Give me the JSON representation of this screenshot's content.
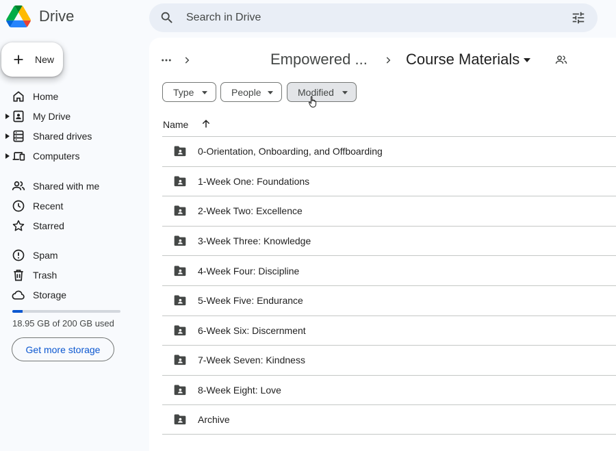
{
  "app": {
    "title": "Drive"
  },
  "search": {
    "placeholder": "Search in Drive"
  },
  "sidebar": {
    "new_label": "New",
    "items": [
      {
        "label": "Home",
        "icon": "home-icon"
      },
      {
        "label": "My Drive",
        "icon": "my-drive-icon"
      },
      {
        "label": "Shared drives",
        "icon": "shared-drives-icon"
      },
      {
        "label": "Computers",
        "icon": "computers-icon"
      },
      {
        "label": "Shared with me",
        "icon": "shared-with-me-icon"
      },
      {
        "label": "Recent",
        "icon": "clock-icon"
      },
      {
        "label": "Starred",
        "icon": "star-icon"
      },
      {
        "label": "Spam",
        "icon": "spam-icon"
      },
      {
        "label": "Trash",
        "icon": "trash-icon"
      },
      {
        "label": "Storage",
        "icon": "cloud-icon"
      }
    ],
    "storage": {
      "used_text": "18.95 GB of 200 GB used",
      "used_fraction": 0.095,
      "button_label": "Get more storage"
    }
  },
  "breadcrumb": {
    "parent": "Empowered ...",
    "current": "Course Materials"
  },
  "filters": {
    "type": "Type",
    "people": "People",
    "modified": "Modified"
  },
  "list": {
    "column_name": "Name",
    "items": [
      "0-Orientation, Onboarding, and Offboarding",
      "1-Week One: Foundations",
      "2-Week Two: Excellence",
      "3-Week Three: Knowledge",
      "4-Week Four: Discipline",
      "5-Week Five: Endurance",
      "6-Week Six: Discernment",
      "7-Week Seven: Kindness",
      "8-Week Eight: Love",
      "Archive"
    ]
  },
  "colors": {
    "accent": "#0b57d0",
    "background": "#f8fafd",
    "search_bg": "#e9eef6"
  }
}
